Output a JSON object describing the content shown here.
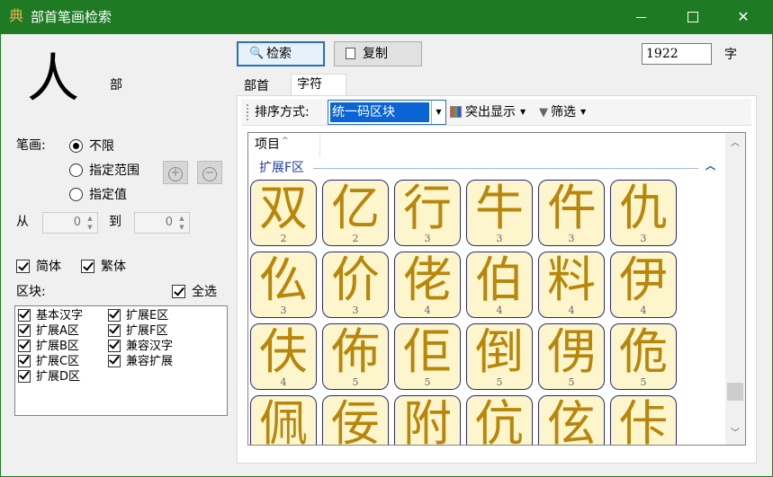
{
  "window": {
    "title": "部首笔画检索",
    "app_icon": "典",
    "minimize_icon": "minimize-icon",
    "maximize_icon": "maximize-icon",
    "close_icon": "✕"
  },
  "radical": {
    "char": "人",
    "label": "部"
  },
  "strokes": {
    "label": "笔画:",
    "options": [
      "不限",
      "指定范围",
      "指定值"
    ],
    "selected": "不限",
    "add_icon": "+",
    "remove_icon": "−",
    "from_label": "从",
    "from_value": "0",
    "to_label": "到",
    "to_value": "0"
  },
  "filters": {
    "simplified": "简体",
    "traditional": "繁体"
  },
  "blocks": {
    "label": "区块:",
    "select_all": "全选",
    "items": [
      "基本汉字",
      "扩展A区",
      "扩展B区",
      "扩展C区",
      "扩展D区",
      "扩展E区",
      "扩展F区",
      "兼容汉字",
      "兼容扩展"
    ]
  },
  "toolbar": {
    "search_label": "检索",
    "copy_label": "复制",
    "count_value": "1922",
    "count_unit": "字"
  },
  "tabs": [
    "部首",
    "字符"
  ],
  "active_tab": "字符",
  "sort": {
    "label": "排序方式:",
    "selected": "统一码区块",
    "highlight_label": "突出显示",
    "filter_label": "筛选"
  },
  "list": {
    "column_header": "项目",
    "group_name": "扩展F区",
    "chars": [
      {
        "c": "双",
        "s": "2"
      },
      {
        "c": "亿",
        "s": "2"
      },
      {
        "c": "行",
        "s": "3"
      },
      {
        "c": "牛",
        "s": "3"
      },
      {
        "c": "仵",
        "s": "3"
      },
      {
        "c": "仇",
        "s": "3"
      },
      {
        "c": "仫",
        "s": "3"
      },
      {
        "c": "价",
        "s": "3"
      },
      {
        "c": "佬",
        "s": "4"
      },
      {
        "c": "伯",
        "s": "4"
      },
      {
        "c": "料",
        "s": "4"
      },
      {
        "c": "伊",
        "s": "4"
      },
      {
        "c": "伕",
        "s": "4"
      },
      {
        "c": "佈",
        "s": "5"
      },
      {
        "c": "佢",
        "s": "5"
      },
      {
        "c": "倒",
        "s": "5"
      },
      {
        "c": "侽",
        "s": "5"
      },
      {
        "c": "佹",
        "s": "5"
      },
      {
        "c": "佩",
        "s": ""
      },
      {
        "c": "佞",
        "s": ""
      },
      {
        "c": "附",
        "s": ""
      },
      {
        "c": "伉",
        "s": ""
      },
      {
        "c": "伭",
        "s": ""
      },
      {
        "c": "佧",
        "s": ""
      }
    ]
  }
}
